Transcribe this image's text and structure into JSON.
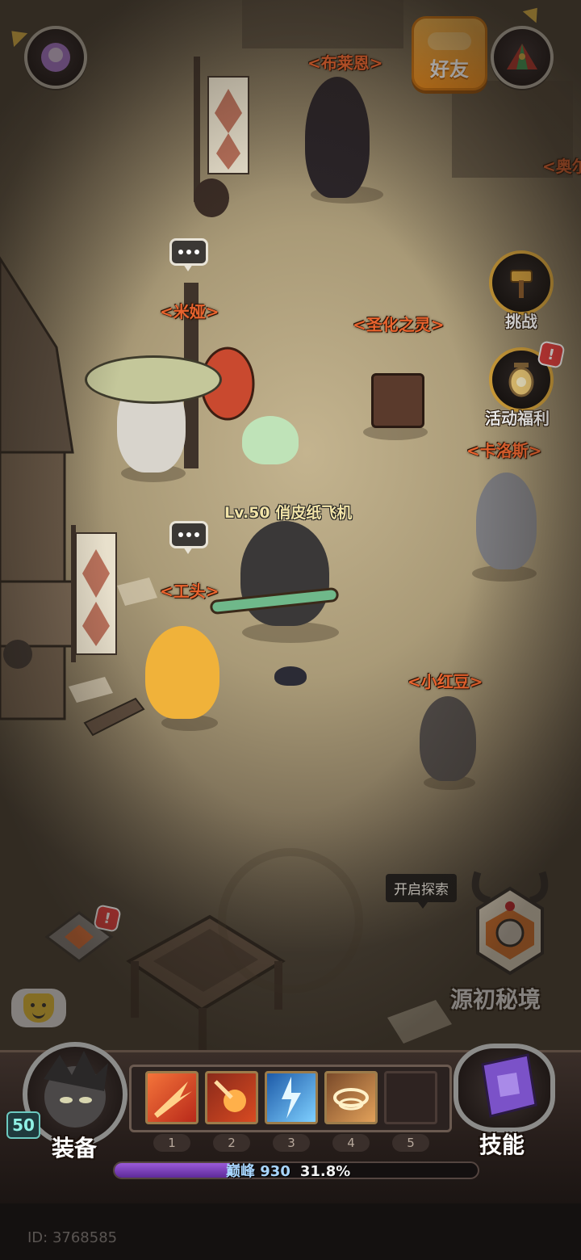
{
  "top_bar": {
    "friend_label": "好友"
  },
  "npcs": [
    {
      "key": "bulaien",
      "name": "<布莱恩>"
    },
    {
      "key": "ao",
      "name": "<奥尔"
    },
    {
      "key": "miya",
      "name": "<米娅>"
    },
    {
      "key": "shenghua",
      "name": "<圣化之灵>"
    },
    {
      "key": "kaluosi",
      "name": "<卡洛斯>"
    },
    {
      "key": "gongtou",
      "name": "<工头>"
    },
    {
      "key": "xiaohongdou",
      "name": "<小红豆>"
    }
  ],
  "player": {
    "name_tag": "Lv.50 俏皮纸飞机"
  },
  "side_buttons": {
    "challenge_label": "挑战",
    "event_label": "活动福利",
    "event_alert": "!"
  },
  "explore": {
    "tooltip": "开启探索",
    "dungeon_label": "源初秘境"
  },
  "hud": {
    "level": "50",
    "equip_label": "装备",
    "skills_label": "技能",
    "slots": [
      "1",
      "2",
      "3",
      "4",
      "5"
    ],
    "xp_label": "巅峰 930",
    "xp_percent": "31.8%",
    "xp_fraction": 0.318,
    "accent_color": "#9a5ad8"
  },
  "footer": {
    "user_id": "ID: 3768585"
  },
  "misc": {
    "crystal_alert": "!"
  }
}
